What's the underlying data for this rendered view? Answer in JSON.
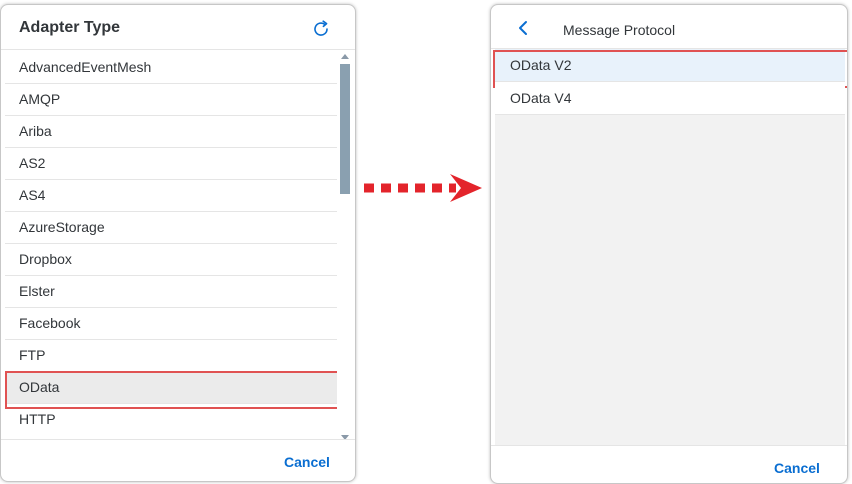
{
  "left_dialog": {
    "title": "Adapter Type",
    "refresh_icon": "refresh-icon",
    "items": [
      {
        "label": "AdvancedEventMesh",
        "selected": false
      },
      {
        "label": "AMQP",
        "selected": false
      },
      {
        "label": "Ariba",
        "selected": false
      },
      {
        "label": "AS2",
        "selected": false
      },
      {
        "label": "AS4",
        "selected": false
      },
      {
        "label": "AzureStorage",
        "selected": false
      },
      {
        "label": "Dropbox",
        "selected": false
      },
      {
        "label": "Elster",
        "selected": false
      },
      {
        "label": "Facebook",
        "selected": false
      },
      {
        "label": "FTP",
        "selected": false
      },
      {
        "label": "OData",
        "selected": true
      },
      {
        "label": "HTTP",
        "selected": false
      }
    ],
    "cancel_label": "Cancel"
  },
  "right_dialog": {
    "back_icon": "chevron-left-icon",
    "title": "Message Protocol",
    "items": [
      {
        "label": "OData V2",
        "selected": true
      },
      {
        "label": "OData V4",
        "selected": false
      }
    ],
    "cancel_label": "Cancel"
  },
  "colors": {
    "accent": "#0a6ed1",
    "highlight_border": "#e05252",
    "arrow": "#e3242b",
    "selected_row": "#ebebeb",
    "selected_protocol_row": "#e8f2fb"
  }
}
